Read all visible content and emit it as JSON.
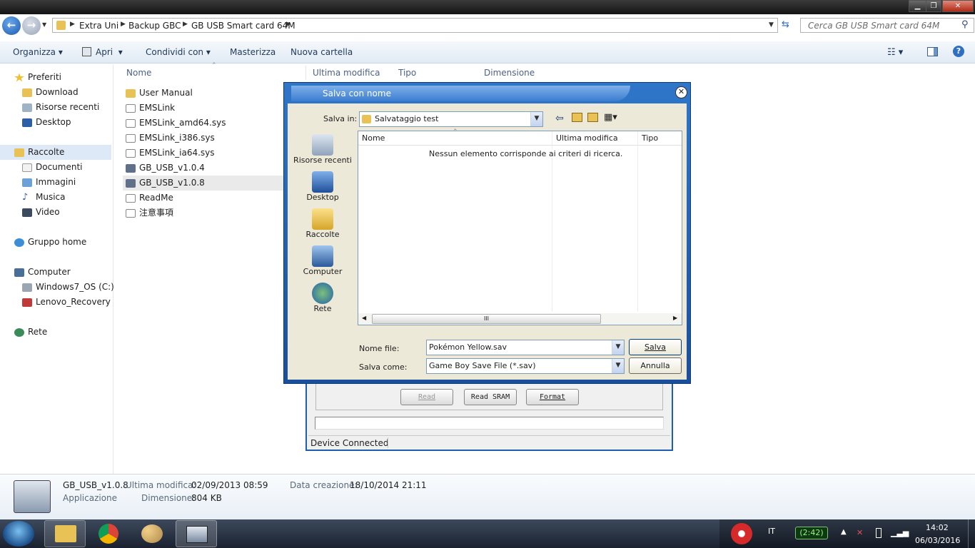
{
  "titlebar": {
    "minimize": "▁",
    "maximize": "❐",
    "close": "✕"
  },
  "address": {
    "crumbs": [
      "Extra Uni",
      "Backup GBC",
      "GB USB Smart card 64M"
    ],
    "search_placeholder": "Cerca GB USB Smart card 64M"
  },
  "toolbar": {
    "organizza": "Organizza",
    "apri": "Apri",
    "condividi": "Condividi con",
    "masterizza": "Masterizza",
    "nuova_cartella": "Nuova cartella"
  },
  "nav": {
    "preferiti": "Preferiti",
    "download": "Download",
    "risorse": "Risorse recenti",
    "desktop": "Desktop",
    "raccolte": "Raccolte",
    "documenti": "Documenti",
    "immagini": "Immagini",
    "musica": "Musica",
    "video": "Video",
    "gruppo": "Gruppo home",
    "computer": "Computer",
    "win7": "Windows7_OS (C:)",
    "lenovo": "Lenovo_Recovery (Q",
    "rete": "Rete"
  },
  "columns": {
    "nome": "Nome",
    "ultima": "Ultima modifica",
    "tipo": "Tipo",
    "dimensione": "Dimensione"
  },
  "files": [
    "User Manual",
    "EMSLink",
    "EMSLink_amd64.sys",
    "EMSLink_i386.sys",
    "EMSLink_ia64.sys",
    "GB_USB_v1.0.4",
    "GB_USB_v1.0.8",
    "ReadMe",
    "注意事項"
  ],
  "details": {
    "name": "GB_USB_v1.0.8",
    "type": "Applicazione",
    "mod_label": "Ultima modifica:",
    "mod_value": "02/09/2013 08:59",
    "size_label": "Dimensione:",
    "size_value": "804 KB",
    "created_label": "Data creazione:",
    "created_value": "18/10/2014 21:11"
  },
  "bgapp": {
    "read": "Read",
    "read_sram": "Read SRAM",
    "format": "Format",
    "status": "Device Connected"
  },
  "dialog": {
    "title": "Salva con nome",
    "salva_in_label": "Salva in:",
    "salva_in_value": "Salvataggio test",
    "places": [
      "Risorse recenti",
      "Desktop",
      "Raccolte",
      "Computer",
      "Rete"
    ],
    "col_nome": "Nome",
    "col_ultima": "Ultima modifica",
    "col_tipo": "Tipo",
    "empty": "Nessun elemento corrisponde ai criteri di ricerca.",
    "nome_file_label": "Nome file:",
    "nome_file_value": "Pokémon Yellow.sav",
    "salva_come_label": "Salva come:",
    "salva_come_value": "Game Boy Save File (*.sav)",
    "salva": "Salva",
    "annulla": "Annulla",
    "scroll_grip": "III"
  },
  "taskbar": {
    "lang": "IT",
    "battery": "(2:42)",
    "time": "14:02",
    "date": "06/03/2016"
  }
}
